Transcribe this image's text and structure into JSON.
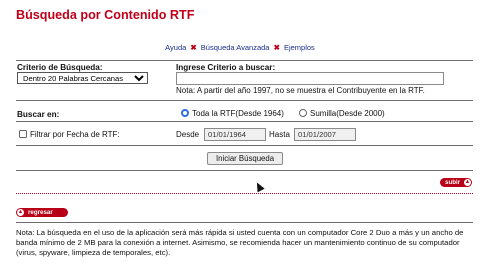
{
  "page": {
    "title": "Búsqueda por Contenido RTF"
  },
  "links": {
    "ayuda": "Ayuda",
    "avanzada": "Búsqueda Avanzada",
    "ejemplos": "Ejemplos",
    "separator": "✖"
  },
  "criterio": {
    "label": "Criterio de Búsqueda:",
    "selected": "Dentro 20 Palabras Cercanas"
  },
  "ingrese": {
    "label": "Ingrese Criterio a buscar:",
    "value": "",
    "note": "Nota: A partir del año 1997, no se muestra el Contribuyente en la RTF."
  },
  "buscar_en": {
    "label": "Buscar en:",
    "options": [
      {
        "label": "Toda la RTF(Desde 1964)",
        "selected": true
      },
      {
        "label": "Sumilla(Desde 2000)",
        "selected": false
      }
    ]
  },
  "filtro": {
    "label": "Filtrar por Fecha de RTF:",
    "checked": false,
    "desde_label": "Desde",
    "desde_value": "01/01/1964",
    "hasta_label": "Hasta",
    "hasta_value": "01/01/2007"
  },
  "search_button": "Iniciar Búsqueda",
  "subir": "subir",
  "regresar": "regresar",
  "footer_note": "Nota: La búsqueda en el uso de la aplicación será más rápida si usted cuenta con un computador Core 2 Duo a más y un ancho de banda mínimo de 2 MB para la conexión a internet. Asimismo, se recomienda hacer un mantenimiento continuo de su computador (virus, spyware, limpieza de temporales, etc).",
  "colors": {
    "title": "#c0001a",
    "link": "#1a2f8a",
    "pill": "#b80017"
  }
}
